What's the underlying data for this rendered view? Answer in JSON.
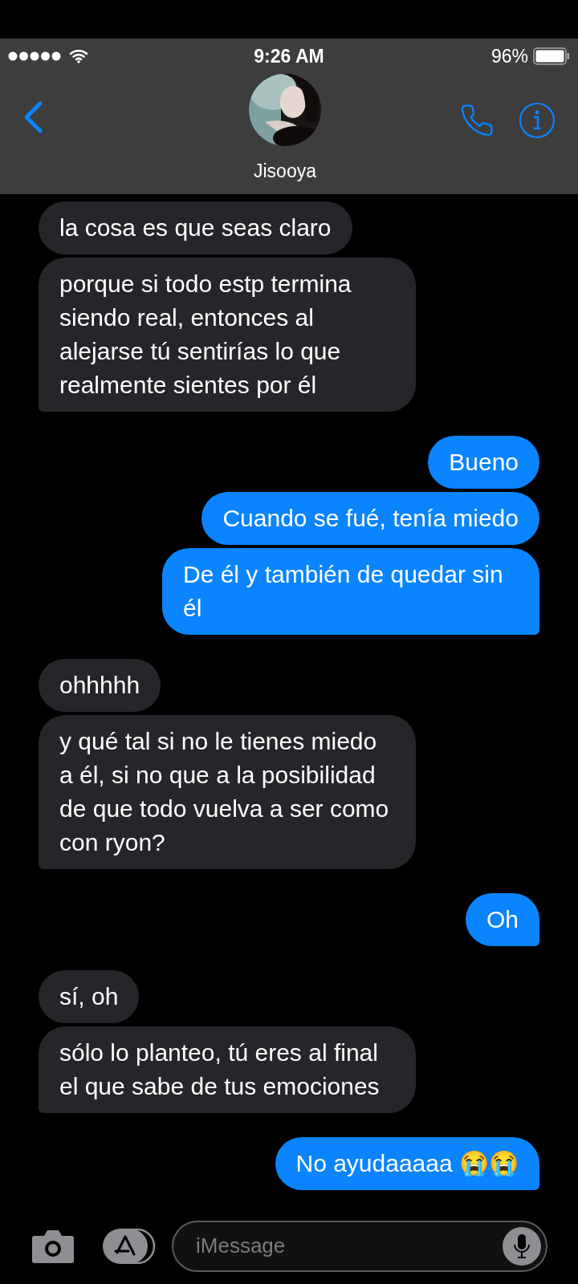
{
  "status_bar": {
    "time": "9:26 AM",
    "battery": "96%"
  },
  "contact": {
    "name": "Jisooya"
  },
  "groups": [
    {
      "kind": "received",
      "messages": [
        "la cosa es que seas claro",
        "porque si todo estp termina siendo real, entonces al alejarse tú sentirías lo que realmente sientes por él"
      ]
    },
    {
      "kind": "sent",
      "messages": [
        "Bueno",
        "Cuando se fué, tenía miedo",
        "De él y también de quedar sin él"
      ]
    },
    {
      "kind": "received",
      "messages": [
        "ohhhhh",
        "y qué tal si no le tienes miedo a él, si no que a la posibilidad de que todo vuelva a ser como con ryon?"
      ]
    },
    {
      "kind": "sent",
      "messages": [
        "Oh"
      ]
    },
    {
      "kind": "received",
      "messages": [
        "sí, oh",
        "sólo lo planteo, tú eres al final el que sabe de tus emociones"
      ]
    },
    {
      "kind": "sent",
      "messages": [
        "No ayudaaaaa 😭😭"
      ]
    }
  ],
  "composer": {
    "placeholder": "iMessage"
  }
}
